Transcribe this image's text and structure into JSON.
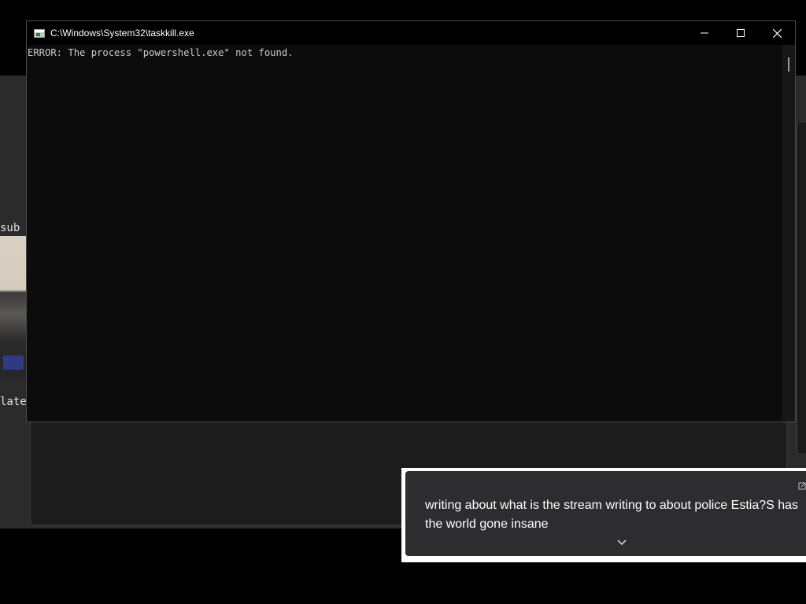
{
  "background": {
    "left_text_top": "sub",
    "left_text_bottom": "lates"
  },
  "console": {
    "title": "C:\\Windows\\System32\\taskkill.exe",
    "output_lines": [
      "ERROR: The process \"powershell.exe\" not found."
    ],
    "window_buttons": {
      "minimize_icon": "minimize-icon",
      "maximize_icon": "maximize-icon",
      "close_icon": "close-icon"
    },
    "colors": {
      "background": "#0c0c0c",
      "text": "#cccccc",
      "titlebar": "#000000"
    }
  },
  "notification": {
    "text": "writing about what is the stream writing to about police Estia?S has the world gone insane",
    "expand_icon": "chevron-down-icon",
    "popout_icon": "popout-icon",
    "colors": {
      "background": "#2d2d30",
      "border": "#ffffff",
      "text": "#ffffff"
    }
  }
}
